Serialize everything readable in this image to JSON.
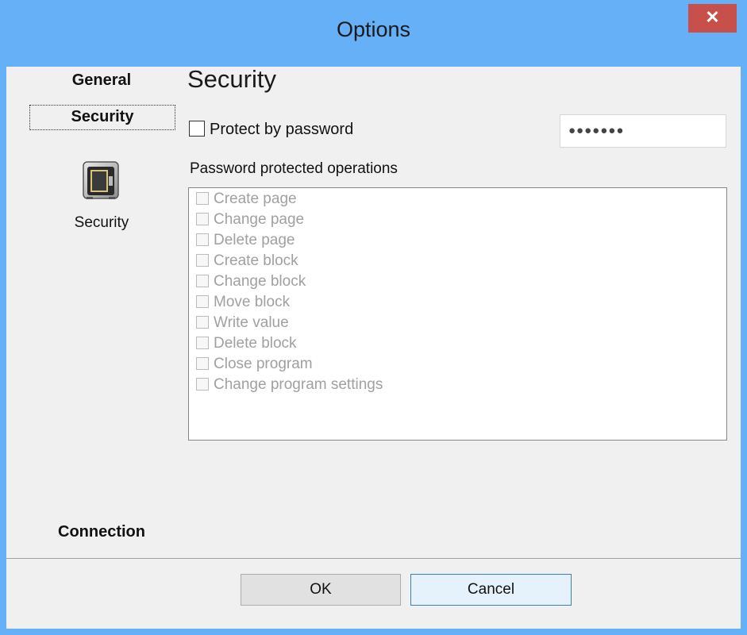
{
  "window": {
    "title": "Options",
    "close_glyph": "✕",
    "accent_color": "#65b0f6",
    "close_color": "#c7504a"
  },
  "sidebar": {
    "groups": [
      "General",
      "Security",
      "Connection"
    ],
    "selected": "Security",
    "items": [
      {
        "label": "Security",
        "icon": "safe-icon"
      }
    ]
  },
  "main": {
    "title": "Security",
    "protect_label": "Protect by password",
    "protect_checked": false,
    "password_mask": "●●●●●●●",
    "operations_label": "Password protected operations",
    "operations": [
      "Create page",
      "Change page",
      "Delete page",
      "Create block",
      "Change block",
      "Move block",
      "Write value",
      "Delete block",
      "Close program",
      "Change program settings"
    ]
  },
  "footer": {
    "ok_label": "OK",
    "cancel_label": "Cancel"
  }
}
